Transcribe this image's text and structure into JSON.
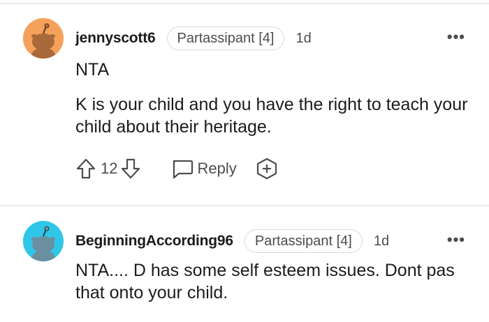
{
  "comments": [
    {
      "username": "jennyscott6",
      "flair": "Partassipant [4]",
      "age": "1d",
      "avatar_color": "#f5a15c",
      "body": [
        "NTA",
        "K is your child and you have the right to teach your child about their heritage."
      ],
      "vote_count": "12",
      "reply_label": "Reply",
      "icons": [
        "upvote-icon",
        "downvote-icon",
        "reply-icon",
        "award-icon",
        "more-icon"
      ]
    },
    {
      "username": "BeginningAccording96",
      "flair": "Partassipant [4]",
      "age": "1d",
      "avatar_color": "#2fc6e8",
      "body": [
        "NTA.... D has some self esteem issues. Dont pas that onto your child."
      ],
      "icons": [
        "more-icon"
      ]
    }
  ],
  "more_label": "•••"
}
